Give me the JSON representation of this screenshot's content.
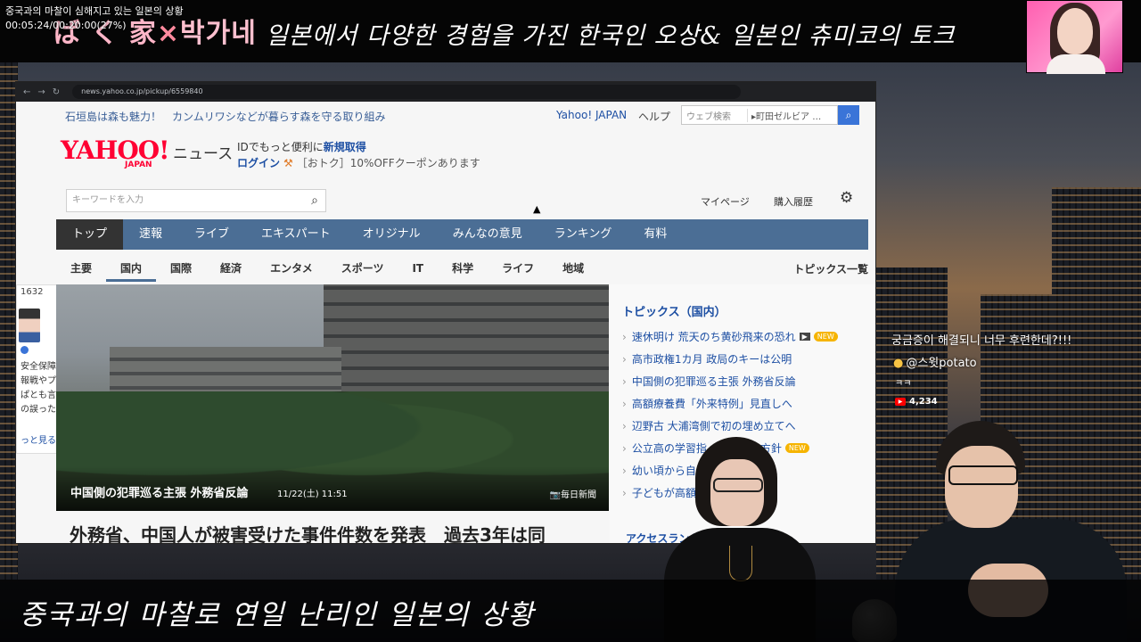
{
  "overlay": {
    "video_title": "중국과의 마찰이 심해지고 있는 일본의 상황",
    "timestamp": "00:05:24/00:20:00(27%)",
    "progress_percent": 27
  },
  "banner": {
    "brand_left": "ば く 家",
    "brand_x": "×",
    "brand_right": "박가네",
    "caption": "일본에서 다양한 경험을 가진 한국인 오상& 일본인 츄미코의 토크"
  },
  "browser": {
    "url": "news.yahoo.co.jp/pickup/6559840",
    "ticker": "石垣島は森も魅力！　カンムリワシなどが暮らす森を守る取り組み",
    "yahoo_japan_link": "Yahoo! JAPAN",
    "help_link": "ヘルプ",
    "web_search_placeholder": "ウェブ検索",
    "location_chip": "▸町田ゼルビア …",
    "search_icon": "search-icon",
    "logo_text": "YAHOO!",
    "logo_sub": "JAPAN",
    "news_word": "ニュース",
    "id_prefix": "IDでもっと便利に",
    "id_link": "新規取得",
    "login_link": "ログイン",
    "promo": "［おトク］10%OFFクーポンあります",
    "keyword_placeholder": "キーワードを入力",
    "mypage": "マイページ",
    "history": "購入履歴",
    "main_nav": [
      "トップ",
      "速報",
      "ライブ",
      "エキスパート",
      "オリジナル",
      "みんなの意見",
      "ランキング",
      "有料"
    ],
    "main_nav_active": 0,
    "sub_nav": [
      "主要",
      "国内",
      "国際",
      "経済",
      "エンタメ",
      "スポーツ",
      "IT",
      "科学",
      "ライフ",
      "地域"
    ],
    "sub_nav_active": 1,
    "topics_list_link": "トピックス一覧",
    "hero": {
      "caption": "中国側の犯罪巡る主張 外務省反論",
      "date": "11/22(土) 11:51",
      "source": "📷毎日新聞"
    },
    "headline": "外務省、中国人が被害受けた事件件数を発表　過去3年は同",
    "side_card": {
      "count": "1632",
      "lines": [
        "安全保障専…",
        "報戦やプロ",
        "ぱとも言える",
        "の誤った情…"
      ],
      "more": "っと見る"
    },
    "topics": {
      "heading": "トピックス（国内）",
      "items": [
        {
          "text": "速休明け 荒天のち黄砂飛来の恐れ",
          "video": true,
          "new": true
        },
        {
          "text": "高市政権1カ月 政局のキーは公明",
          "video": false,
          "new": false
        },
        {
          "text": "中国側の犯罪巡る主張 外務省反論",
          "video": false,
          "new": false
        },
        {
          "text": "高額療養費「外来特例」見直しへ",
          "video": false,
          "new": false
        },
        {
          "text": "辺野古 大浦湾側で初の埋め立てへ",
          "video": false,
          "new": false
        },
        {
          "text": "公立高の学習指…　…業の方針",
          "video": false,
          "new": true
        },
        {
          "text": "幼い頃から自…　…開中学",
          "video": false,
          "new": false
        },
        {
          "text": "子どもが高額…　…否",
          "video": false,
          "new": true
        }
      ],
      "ranking_heading": "アクセスランキング"
    }
  },
  "chat": {
    "message": "궁금증이 해결되니 너무 후련한데?!!!",
    "user": "@스윗potato",
    "reply": "ㅋㅋ",
    "views": "4,234"
  },
  "bottom_caption": "중국과의 마찰로 연일 난리인 일본의 상황",
  "colors": {
    "yahoo_red": "#ff0033",
    "nav_blue": "#4b6e95",
    "link_blue": "#1d4fa3",
    "new_badge": "#f6b400"
  }
}
